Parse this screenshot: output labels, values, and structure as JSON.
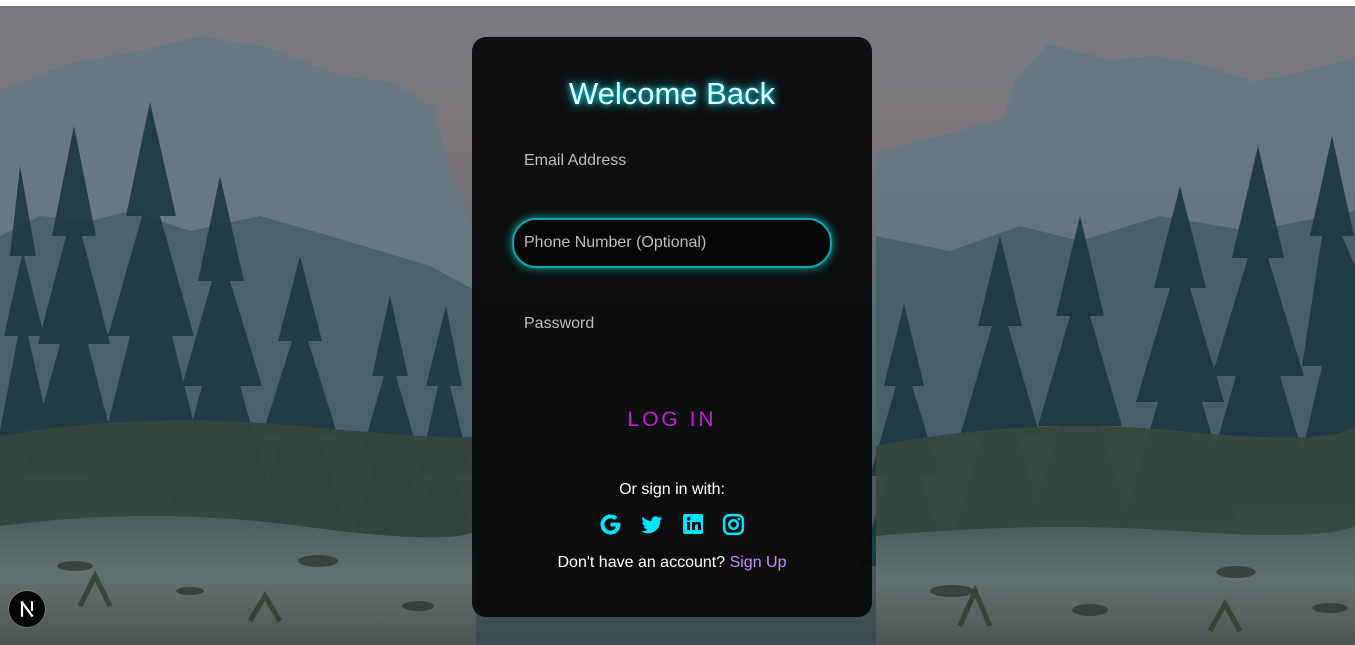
{
  "login": {
    "title": "Welcome Back",
    "email_placeholder": "Email Address",
    "phone_placeholder": "Phone Number (Optional)",
    "password_placeholder": "Password",
    "login_label": "LOG IN",
    "social_label": "Or sign in with:",
    "social_icons": [
      "google-icon",
      "twitter-icon",
      "linkedin-icon",
      "instagram-icon"
    ],
    "signup_prompt": "Don't have an account?",
    "signup_label": "Sign Up"
  },
  "badge": {
    "icon": "nextjs-icon"
  },
  "colors": {
    "accent_cyan": "#00e5ff",
    "button_magenta": "#c51fdc",
    "link_purple": "#c98cff",
    "card_background": "#080808"
  }
}
